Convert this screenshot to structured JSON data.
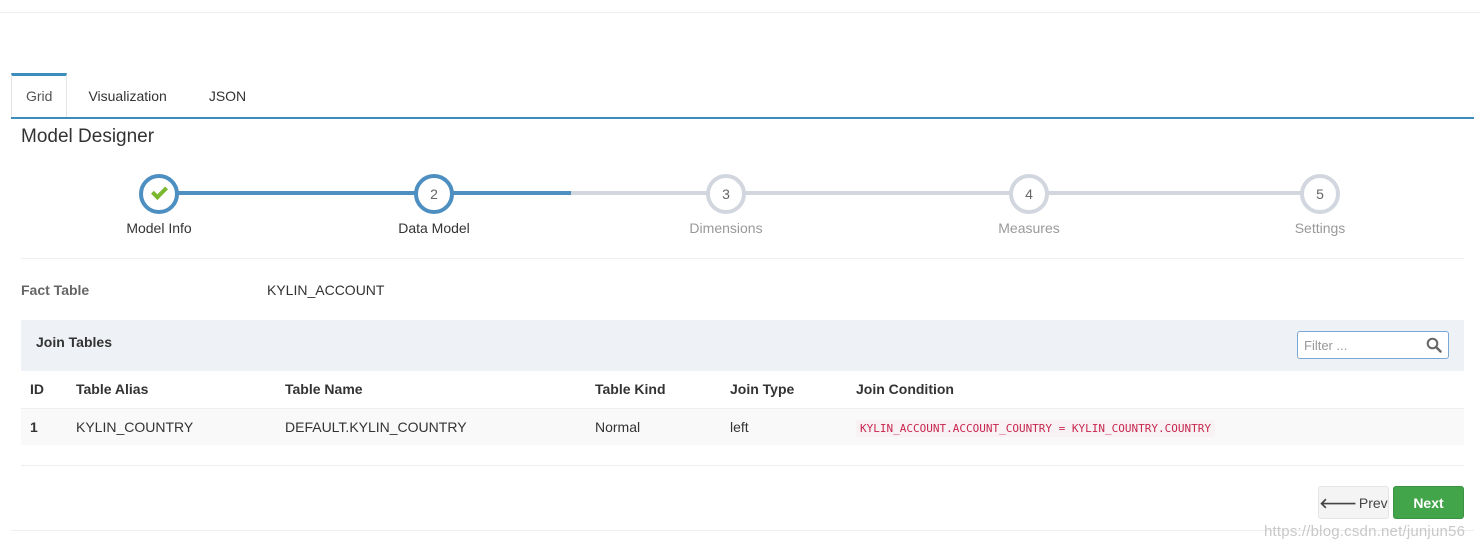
{
  "tabs": [
    {
      "label": "Grid",
      "active": true
    },
    {
      "label": "Visualization",
      "active": false
    },
    {
      "label": "JSON",
      "active": false
    }
  ],
  "designer_title": "Model Designer",
  "wizard": {
    "steps": [
      {
        "number": "1",
        "label": "Model Info",
        "state": "done"
      },
      {
        "number": "2",
        "label": "Data Model",
        "state": "active"
      },
      {
        "number": "3",
        "label": "Dimensions",
        "state": "todo"
      },
      {
        "number": "4",
        "label": "Measures",
        "state": "todo"
      },
      {
        "number": "5",
        "label": "Settings",
        "state": "todo"
      }
    ]
  },
  "fact_table": {
    "label": "Fact Table",
    "value": "KYLIN_ACCOUNT"
  },
  "join_tables": {
    "title": "Join Tables",
    "filter_placeholder": "Filter ...",
    "columns": [
      "ID",
      "Table Alias",
      "Table Name",
      "Table Kind",
      "Join Type",
      "Join Condition"
    ],
    "rows": [
      {
        "id": "1",
        "alias": "KYLIN_COUNTRY",
        "name": "DEFAULT.KYLIN_COUNTRY",
        "kind": "Normal",
        "join_type": "left",
        "condition": "KYLIN_ACCOUNT.ACCOUNT_COUNTRY = KYLIN_COUNTRY.COUNTRY"
      }
    ]
  },
  "buttons": {
    "prev_label": "Prev",
    "next_label": "Next"
  },
  "watermark": "https://blog.csdn.net/junjun56",
  "colors": {
    "accent": "#3c8dbc",
    "step_done": "#4e8fc2",
    "step_todo": "#d2d6de",
    "check": "#7cb82f",
    "next_button": "#42a54a",
    "condition_text": "#c7254e"
  },
  "icons": {
    "step1": "check-icon",
    "filter": "search-icon",
    "prev": "arrow-left-icon",
    "next": "arrow-right-icon"
  }
}
